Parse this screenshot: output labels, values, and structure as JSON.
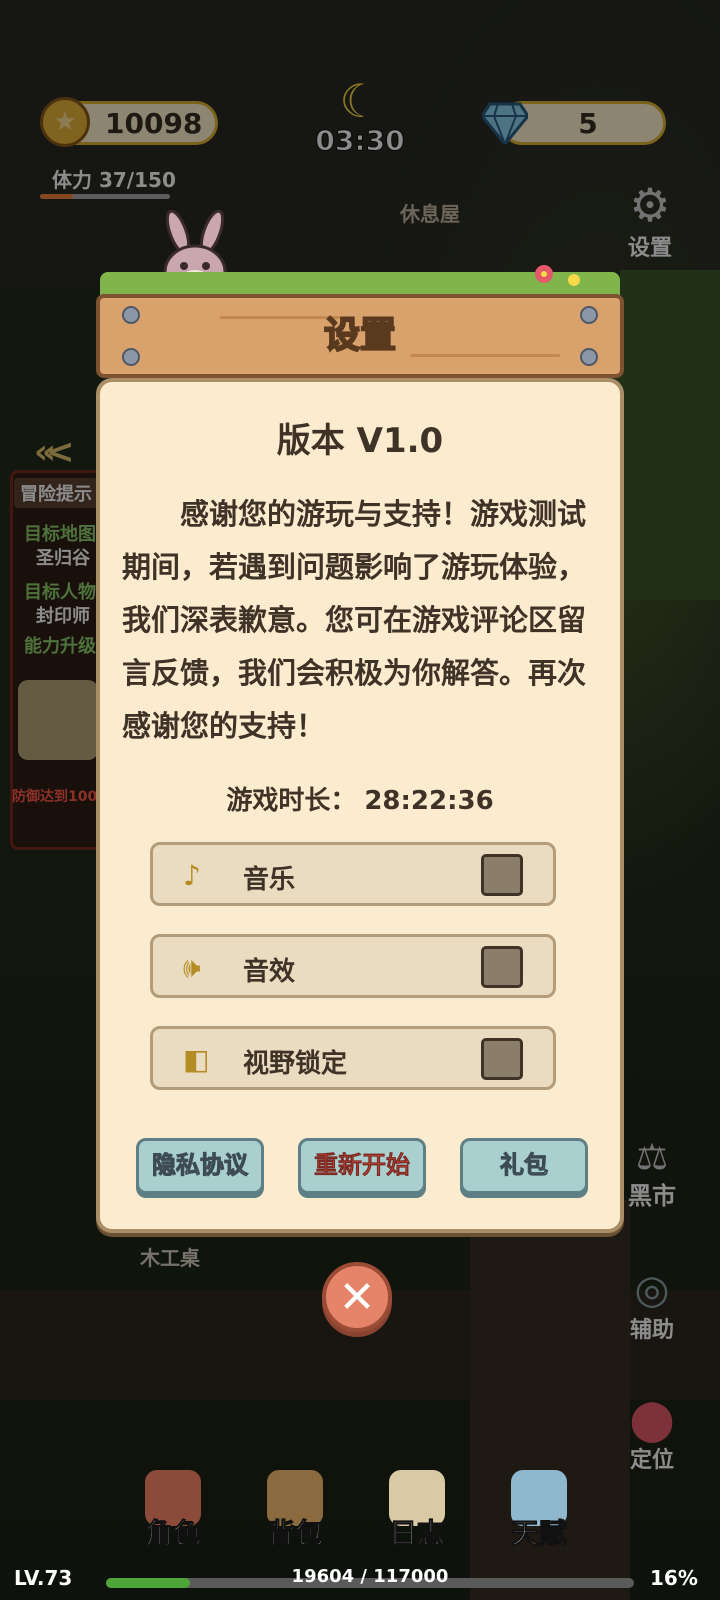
{
  "hud": {
    "coins": "10098",
    "time": "03:30",
    "gems": "5",
    "stamina_label": "体力",
    "stamina_value": "37/150",
    "stamina_fraction": 0.25
  },
  "map_labels": {
    "rest_house": "休息屋",
    "workbench": "木工桌"
  },
  "side_buttons": {
    "settings": "设置",
    "black_market": "黑市",
    "assist": "辅助",
    "locate": "定位"
  },
  "quest": {
    "title": "冒险提示",
    "target_map_label": "目标地图",
    "target_map_value": "圣归谷",
    "target_npc_label": "目标人物",
    "target_npc_value": "封印师",
    "ability_label": "能力升级",
    "reward_text": "防御达到100"
  },
  "modal": {
    "title": "设置",
    "version": "版本 V1.0",
    "thanks_text": "感谢您的游玩与支持！游戏测试期间，若遇到问题影响了游玩体验，我们深表歉意。您可在游戏评论区留言反馈，我们会积极为你解答。再次感谢您的支持！",
    "playtime_label": "游戏时长：",
    "playtime_value": "28:22:36",
    "settings": [
      {
        "label": "音乐",
        "icon": "music-note-icon",
        "checked": false
      },
      {
        "label": "音效",
        "icon": "speaker-icon",
        "checked": false
      },
      {
        "label": "视野锁定",
        "icon": "camera-lock-icon",
        "checked": false
      }
    ],
    "buttons": {
      "privacy": "隐私协议",
      "restart": "重新开始",
      "gift": "礼包"
    }
  },
  "bottom_nav": {
    "role": "角色",
    "bag": "背包",
    "log": "日志",
    "talent": "天赋"
  },
  "level": {
    "label": "LV.73",
    "xp_text": "19604 / 117000",
    "percent": "16%",
    "xp_fraction": 0.16
  },
  "colors": {
    "accent_gold": "#e0b534",
    "panel_bg": "#fbecd0",
    "restart_red": "#ff5a4a"
  }
}
